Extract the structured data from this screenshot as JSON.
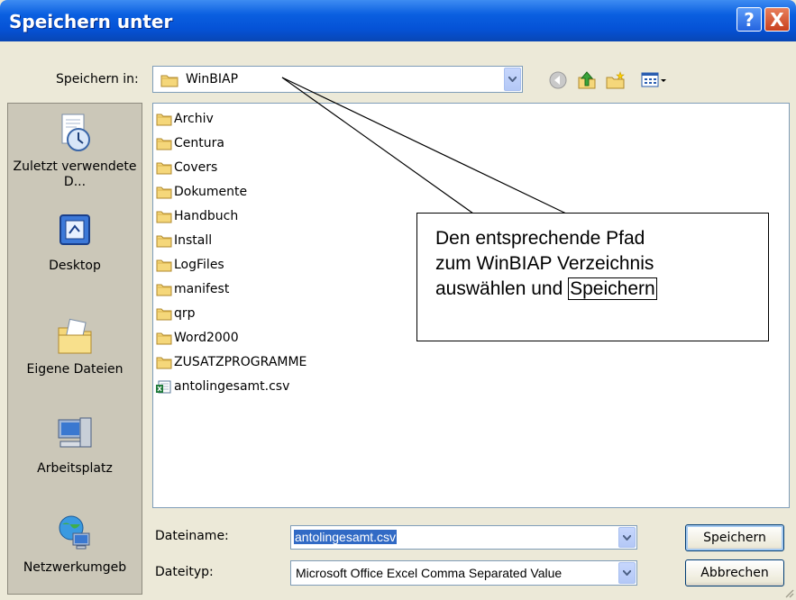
{
  "window": {
    "title": "Speichern unter"
  },
  "titlebar_buttons": {
    "help": "?",
    "close": "X"
  },
  "save_in": {
    "label": "Speichern in:",
    "value": "WinBIAP"
  },
  "toolbar_icons": [
    "back-icon",
    "up-folder-icon",
    "new-folder-icon",
    "view-menu-icon"
  ],
  "places": [
    {
      "label": "Zuletzt verwendete D...",
      "icon": "recent-documents-icon"
    },
    {
      "label": "Desktop",
      "icon": "desktop-icon"
    },
    {
      "label": "Eigene Dateien",
      "icon": "my-documents-icon"
    },
    {
      "label": "Arbeitsplatz",
      "icon": "my-computer-icon"
    },
    {
      "label": "Netzwerkumgeb",
      "icon": "network-icon"
    }
  ],
  "files": [
    {
      "name": "Archiv",
      "type": "folder"
    },
    {
      "name": "Centura",
      "type": "folder"
    },
    {
      "name": "Covers",
      "type": "folder"
    },
    {
      "name": "Dokumente",
      "type": "folder"
    },
    {
      "name": "Handbuch",
      "type": "folder"
    },
    {
      "name": "Install",
      "type": "folder"
    },
    {
      "name": "LogFiles",
      "type": "folder"
    },
    {
      "name": "manifest",
      "type": "folder"
    },
    {
      "name": "qrp",
      "type": "folder"
    },
    {
      "name": "Word2000",
      "type": "folder"
    },
    {
      "name": "ZUSATZPROGRAMME",
      "type": "folder"
    },
    {
      "name": "antolingesamt.csv",
      "type": "excel-csv"
    }
  ],
  "filename": {
    "label": "Dateiname:",
    "value": "antolingesamt.csv"
  },
  "filetype": {
    "label": "Dateityp:",
    "value": "Microsoft Office Excel Comma Separated Value"
  },
  "buttons": {
    "save": "Speichern",
    "cancel": "Abbrechen"
  },
  "callout": {
    "line1": "Den entsprechende Pfad",
    "line2": "zum WinBIAP Verzeichnis",
    "line3_prefix": "auswählen und ",
    "line3_boxed": "Speichern"
  },
  "colors": {
    "titlebar": "#0552d6",
    "dialog_bg": "#ece9d8",
    "places_bg": "#cbc7b8",
    "selection": "#316ac5",
    "folder": "#f5d77a"
  }
}
